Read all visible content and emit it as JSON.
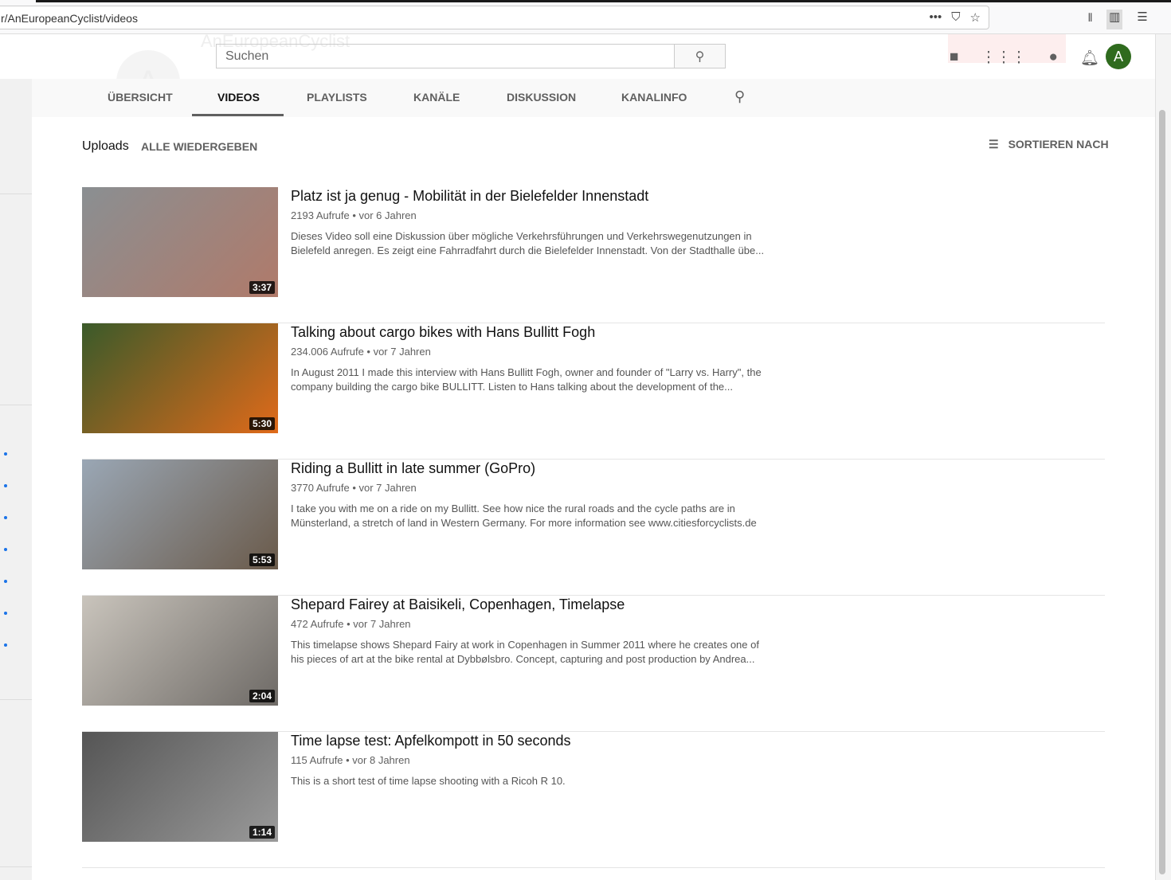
{
  "browser": {
    "url": "r/AnEuropeanCyclist/videos"
  },
  "header": {
    "channel_initial": "A",
    "channel_name": "AnEuropeanCyclist",
    "search_placeholder": "Suchen",
    "avatar_initial": "A"
  },
  "tabs": [
    "ÜBERSICHT",
    "VIDEOS",
    "PLAYLISTS",
    "KANÄLE",
    "DISKUSSION",
    "KANALINFO"
  ],
  "active_tab": "VIDEOS",
  "section": {
    "title": "Uploads",
    "play_all": "ALLE WIEDERGEBEN",
    "sort": "SORTIEREN NACH"
  },
  "videos": [
    {
      "title": "Platz ist ja genug - Mobilität in der Bielefelder Innenstadt",
      "meta": "2193 Aufrufe • vor 6 Jahren",
      "desc": "Dieses Video soll eine Diskussion über mögliche Verkehrsführungen und Verkehrswegenutzungen in Bielefeld anregen. Es zeigt eine Fahrradfahrt durch die Bielefelder Innenstadt. Von der Stadthalle übe...",
      "duration": "3:37",
      "thumb_colors": [
        "#8a8f92",
        "#b07a6a"
      ]
    },
    {
      "title": "Talking about cargo bikes with Hans Bullitt Fogh",
      "meta": "234.006 Aufrufe • vor 7 Jahren",
      "desc": "In August 2011 I made this interview with Hans Bullitt Fogh, owner and founder of \"Larry vs. Harry\", the company building the cargo bike BULLITT. Listen to Hans talking about the development of the...",
      "duration": "5:30",
      "thumb_colors": [
        "#3a5a2a",
        "#e06a1a"
      ]
    },
    {
      "title": "Riding a Bullitt in late summer (GoPro)",
      "meta": "3770 Aufrufe • vor 7 Jahren",
      "desc": "I take you with me on a ride on my Bullitt. See how nice the rural roads and the cycle paths are in Münsterland, a stretch of land in Western Germany. For more information see www.citiesforcyclists.de",
      "duration": "5:53",
      "thumb_colors": [
        "#9aa7b5",
        "#6a5a4a"
      ]
    },
    {
      "title": "Shepard Fairey at Baisikeli, Copenhagen, Timelapse",
      "meta": "472 Aufrufe • vor 7 Jahren",
      "desc": "This timelapse shows Shepard Fairy at work in Copenhagen in Summer 2011 where he creates one of his pieces of art at the bike rental at Dybbølsbro. Concept, capturing and post production by Andrea...",
      "duration": "2:04",
      "thumb_colors": [
        "#c9c4bc",
        "#6e6a66"
      ]
    },
    {
      "title": "Time lapse test: Apfelkompott in 50 seconds",
      "meta": "115 Aufrufe • vor 8 Jahren",
      "desc": "This is a short test of time lapse shooting with a Ricoh R 10.",
      "duration": "1:14",
      "thumb_colors": [
        "#555",
        "#9a9a9a"
      ]
    }
  ]
}
